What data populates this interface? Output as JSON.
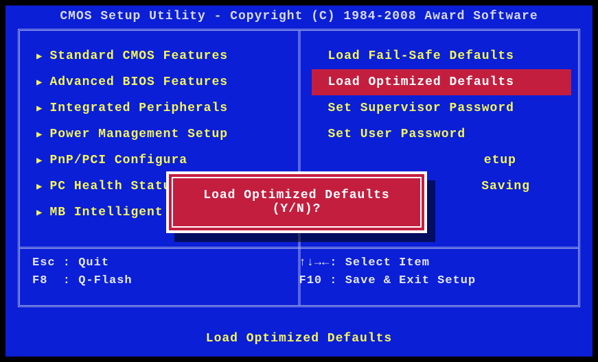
{
  "title": "CMOS Setup Utility - Copyright (C) 1984-2008 Award Software",
  "left_menu": [
    {
      "label": "Standard CMOS Features",
      "arrow": true
    },
    {
      "label": "Advanced BIOS Features",
      "arrow": true
    },
    {
      "label": "Integrated Peripherals",
      "arrow": true
    },
    {
      "label": "Power Management Setup",
      "arrow": true
    },
    {
      "label": "PnP/PCI Configura",
      "arrow": true
    },
    {
      "label": "PC Health Status",
      "arrow": true
    },
    {
      "label": "MB Intelligent Tw",
      "arrow": true
    }
  ],
  "right_menu": [
    {
      "label": "Load Fail-Safe Defaults",
      "selected": false
    },
    {
      "label": "Load Optimized Defaults",
      "selected": true
    },
    {
      "label": "Set Supervisor Password",
      "selected": false
    },
    {
      "label": "Set User Password",
      "selected": false
    },
    {
      "label": "etup",
      "selected": false
    },
    {
      "label": "Saving",
      "selected": false
    }
  ],
  "help": {
    "left": "Esc : Quit\nF8  : Q-Flash",
    "right": "↑↓→←: Select Item\nF10 : Save & Exit Setup"
  },
  "footer_hint": "Load Optimized Defaults",
  "dialog": {
    "text": "Load Optimized Defaults (Y/N)?"
  }
}
